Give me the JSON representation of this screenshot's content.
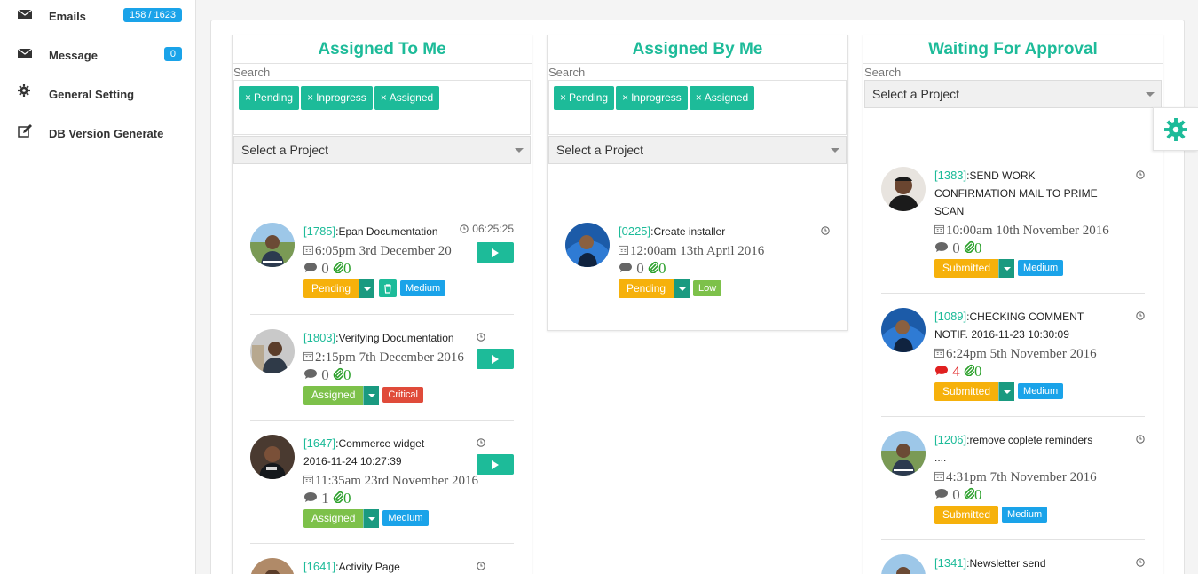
{
  "sidebar": {
    "items": [
      {
        "label": "Emails",
        "icon": "envelope-icon",
        "badge": "158 / 1623"
      },
      {
        "label": "Message",
        "icon": "envelope-icon",
        "badge": "0"
      },
      {
        "label": "General Setting",
        "icon": "gear-icon"
      },
      {
        "label": "DB Version Generate",
        "icon": "edit-icon"
      }
    ]
  },
  "colors": {
    "accent": "#1dbb99",
    "pending": "#f6b10b",
    "assigned": "#7dc14a",
    "medium": "#1aa3e9",
    "critical": "#e04b3a"
  },
  "columns": [
    {
      "title": "Assigned To Me",
      "search_label": "Search",
      "tags": [
        "Pending",
        "Inprogress",
        "Assigned"
      ],
      "project_select": "Select a Project",
      "tasks": [
        {
          "id": "[1785]",
          "title": ":Epan Documentation",
          "timer": "06:25:25",
          "date": "6:05pm 3rd December 20",
          "comments": "0",
          "attachments": "0",
          "status": "Pending",
          "priority": "Medium"
        },
        {
          "id": "[1803]",
          "title": ":Verifying Documentation",
          "date": "2:15pm 7th December 2016",
          "comments": "0",
          "attachments": "0",
          "status": "Assigned",
          "priority": "Critical"
        },
        {
          "id": "[1647]",
          "title": ":Commerce widget",
          "title2": "2016-11-24 10:27:39",
          "date": "11:35am 23rd November 2016",
          "comments": "1",
          "attachments": "0",
          "status": "Assigned",
          "priority": "Medium"
        },
        {
          "id": "[1641]",
          "title": ":Activity Page"
        }
      ]
    },
    {
      "title": "Assigned By Me",
      "search_label": "Search",
      "tags": [
        "Pending",
        "Inprogress",
        "Assigned"
      ],
      "project_select": "Select a Project",
      "tasks": [
        {
          "id": "[0225]",
          "title": ":Create installer",
          "date": "12:00am 13th April 2016",
          "comments": "0",
          "attachments": "0",
          "status": "Pending",
          "priority": "Low"
        }
      ]
    },
    {
      "title": "Waiting For Approval",
      "search_label": "Search",
      "project_select": "Select a Project",
      "tasks": [
        {
          "id": "[1383]",
          "title": ":SEND WORK",
          "title2": "CONFIRMATION MAIL TO PRIME",
          "title3": "SCAN",
          "date": "10:00am 10th November 2016",
          "comments": "0",
          "attachments": "0",
          "status": "Submitted",
          "priority": "Medium"
        },
        {
          "id": "[1089]",
          "title": ":CHECKING COMMENT",
          "title2": "NOTIF. 2016-11-23 10:30:09",
          "date": "6:24pm 5th November 2016",
          "comments": "4",
          "attachments": "0",
          "status": "Submitted",
          "priority": "Medium"
        },
        {
          "id": "[1206]",
          "title": ":remove coplete reminders",
          "title2": "....",
          "date": "4:31pm 7th November 2016",
          "comments": "0",
          "attachments": "0",
          "status": "Submitted",
          "priority": "Medium"
        },
        {
          "id": "[1341]",
          "title": ":Newsletter send"
        }
      ]
    }
  ]
}
